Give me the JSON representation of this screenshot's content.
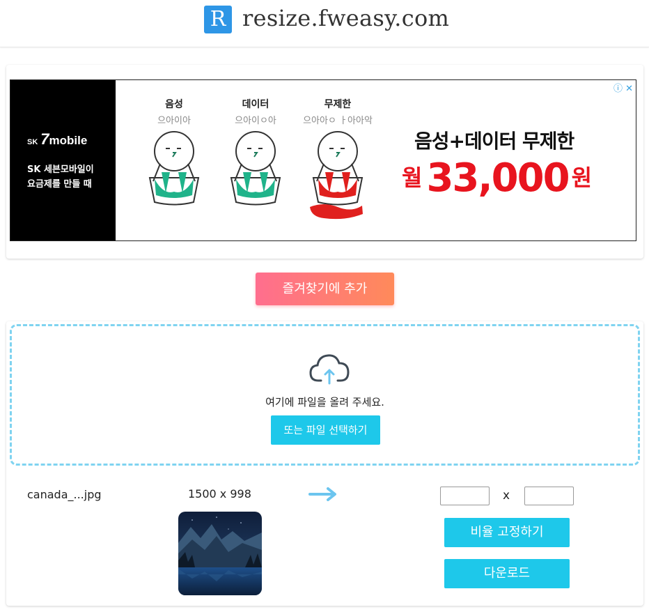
{
  "header": {
    "logo_letter": "R",
    "site_name": "resize.fweasy.com"
  },
  "ad": {
    "brand": {
      "sk": "SK",
      "seven": "7",
      "mobile": "mobile"
    },
    "slogan_line1": "SK 세븐모바일이",
    "slogan_line2": "요금제를 만들 때",
    "cartoons": [
      {
        "title": "음성",
        "sub": "으아이아",
        "liquid_color": "#20b38a"
      },
      {
        "title": "데이터",
        "sub": "으아이ㅇ아",
        "liquid_color": "#20b38a"
      },
      {
        "title": "무제한",
        "sub": "으아아ㅇ ㅏ아아악",
        "liquid_color": "#e0201e"
      }
    ],
    "headline": "음성+데이터 무제한",
    "price_prefix": "월",
    "price": "33,000",
    "price_suffix": "원",
    "info_icons": "ⓘ ✕",
    "colors": {
      "price": "#e8141e",
      "info": "#34a0e0"
    }
  },
  "favorite_button": "즐겨찾기에 추가",
  "dropzone": {
    "prompt": "여기에 파일을 올려 주세요.",
    "select_button": "또는 파일 선택하기",
    "icon": "cloud-upload-icon"
  },
  "file": {
    "name": "canada_...jpg",
    "dimensions": "1500 x 998",
    "width_value": "",
    "height_value": "",
    "times_symbol": "x"
  },
  "buttons": {
    "ratio_lock": "비율 고정하기",
    "download": "다운로드"
  },
  "colors": {
    "accent": "#1ec8ea",
    "logo": "#2e96e6",
    "dropzone_border": "#7fd3f0",
    "favorite_gradient_start": "#ff6e8e",
    "favorite_gradient_end": "#ff8a5a"
  }
}
